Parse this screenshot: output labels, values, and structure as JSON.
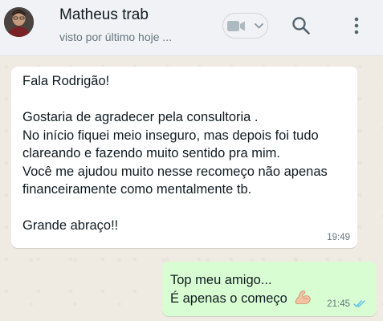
{
  "header": {
    "contact_name": "Matheus trab",
    "status": "visto por último hoje ...",
    "icons": [
      "avatar",
      "video-call-icon",
      "chevron-down-icon",
      "search-icon",
      "more-vertical-icon"
    ]
  },
  "messages": [
    {
      "direction": "incoming",
      "lines": [
        "Fala Rodrigão!",
        "",
        "Gostaria de agradecer pela consultoria .",
        "No início fiquei meio inseguro, mas depois foi tudo",
        "clareando e fazendo muito sentido pra mim.",
        "Você me ajudou muito nesse recomeço não apenas",
        "financeiramente como mentalmente tb.",
        "",
        "Grande abraço!!"
      ],
      "time": "19:49"
    },
    {
      "direction": "outgoing",
      "lines": [
        "Top meu amigo...",
        "É apenas o começo"
      ],
      "emoji": "flexed-biceps-icon",
      "time": "21:45",
      "status_icon": "double-check-read-icon"
    }
  ],
  "colors": {
    "header_bg": "#f0f2f5",
    "chat_bg": "#efeae2",
    "incoming_bubble": "#ffffff",
    "outgoing_bubble": "#d9fdd3",
    "read_ticks": "#53bdeb",
    "text": "#111b21",
    "secondary_text": "#667781"
  }
}
